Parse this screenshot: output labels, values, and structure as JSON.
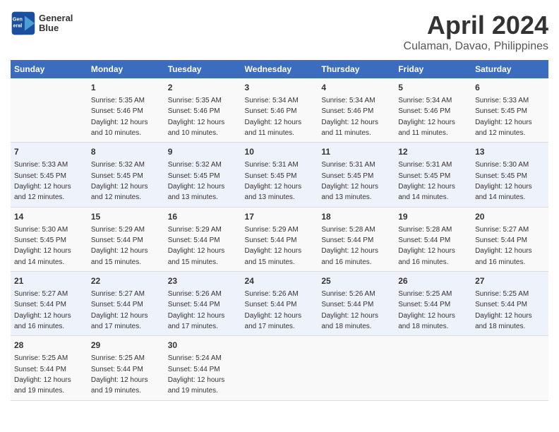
{
  "header": {
    "logo_line1": "General",
    "logo_line2": "Blue",
    "title": "April 2024",
    "subtitle": "Culaman, Davao, Philippines"
  },
  "columns": [
    "Sunday",
    "Monday",
    "Tuesday",
    "Wednesday",
    "Thursday",
    "Friday",
    "Saturday"
  ],
  "weeks": [
    [
      {
        "day": "",
        "info": ""
      },
      {
        "day": "1",
        "info": "Sunrise: 5:35 AM\nSunset: 5:46 PM\nDaylight: 12 hours\nand 10 minutes."
      },
      {
        "day": "2",
        "info": "Sunrise: 5:35 AM\nSunset: 5:46 PM\nDaylight: 12 hours\nand 10 minutes."
      },
      {
        "day": "3",
        "info": "Sunrise: 5:34 AM\nSunset: 5:46 PM\nDaylight: 12 hours\nand 11 minutes."
      },
      {
        "day": "4",
        "info": "Sunrise: 5:34 AM\nSunset: 5:46 PM\nDaylight: 12 hours\nand 11 minutes."
      },
      {
        "day": "5",
        "info": "Sunrise: 5:34 AM\nSunset: 5:46 PM\nDaylight: 12 hours\nand 11 minutes."
      },
      {
        "day": "6",
        "info": "Sunrise: 5:33 AM\nSunset: 5:45 PM\nDaylight: 12 hours\nand 12 minutes."
      }
    ],
    [
      {
        "day": "7",
        "info": "Sunrise: 5:33 AM\nSunset: 5:45 PM\nDaylight: 12 hours\nand 12 minutes."
      },
      {
        "day": "8",
        "info": "Sunrise: 5:32 AM\nSunset: 5:45 PM\nDaylight: 12 hours\nand 12 minutes."
      },
      {
        "day": "9",
        "info": "Sunrise: 5:32 AM\nSunset: 5:45 PM\nDaylight: 12 hours\nand 13 minutes."
      },
      {
        "day": "10",
        "info": "Sunrise: 5:31 AM\nSunset: 5:45 PM\nDaylight: 12 hours\nand 13 minutes."
      },
      {
        "day": "11",
        "info": "Sunrise: 5:31 AM\nSunset: 5:45 PM\nDaylight: 12 hours\nand 13 minutes."
      },
      {
        "day": "12",
        "info": "Sunrise: 5:31 AM\nSunset: 5:45 PM\nDaylight: 12 hours\nand 14 minutes."
      },
      {
        "day": "13",
        "info": "Sunrise: 5:30 AM\nSunset: 5:45 PM\nDaylight: 12 hours\nand 14 minutes."
      }
    ],
    [
      {
        "day": "14",
        "info": "Sunrise: 5:30 AM\nSunset: 5:45 PM\nDaylight: 12 hours\nand 14 minutes."
      },
      {
        "day": "15",
        "info": "Sunrise: 5:29 AM\nSunset: 5:44 PM\nDaylight: 12 hours\nand 15 minutes."
      },
      {
        "day": "16",
        "info": "Sunrise: 5:29 AM\nSunset: 5:44 PM\nDaylight: 12 hours\nand 15 minutes."
      },
      {
        "day": "17",
        "info": "Sunrise: 5:29 AM\nSunset: 5:44 PM\nDaylight: 12 hours\nand 15 minutes."
      },
      {
        "day": "18",
        "info": "Sunrise: 5:28 AM\nSunset: 5:44 PM\nDaylight: 12 hours\nand 16 minutes."
      },
      {
        "day": "19",
        "info": "Sunrise: 5:28 AM\nSunset: 5:44 PM\nDaylight: 12 hours\nand 16 minutes."
      },
      {
        "day": "20",
        "info": "Sunrise: 5:27 AM\nSunset: 5:44 PM\nDaylight: 12 hours\nand 16 minutes."
      }
    ],
    [
      {
        "day": "21",
        "info": "Sunrise: 5:27 AM\nSunset: 5:44 PM\nDaylight: 12 hours\nand 16 minutes."
      },
      {
        "day": "22",
        "info": "Sunrise: 5:27 AM\nSunset: 5:44 PM\nDaylight: 12 hours\nand 17 minutes."
      },
      {
        "day": "23",
        "info": "Sunrise: 5:26 AM\nSunset: 5:44 PM\nDaylight: 12 hours\nand 17 minutes."
      },
      {
        "day": "24",
        "info": "Sunrise: 5:26 AM\nSunset: 5:44 PM\nDaylight: 12 hours\nand 17 minutes."
      },
      {
        "day": "25",
        "info": "Sunrise: 5:26 AM\nSunset: 5:44 PM\nDaylight: 12 hours\nand 18 minutes."
      },
      {
        "day": "26",
        "info": "Sunrise: 5:25 AM\nSunset: 5:44 PM\nDaylight: 12 hours\nand 18 minutes."
      },
      {
        "day": "27",
        "info": "Sunrise: 5:25 AM\nSunset: 5:44 PM\nDaylight: 12 hours\nand 18 minutes."
      }
    ],
    [
      {
        "day": "28",
        "info": "Sunrise: 5:25 AM\nSunset: 5:44 PM\nDaylight: 12 hours\nand 19 minutes."
      },
      {
        "day": "29",
        "info": "Sunrise: 5:25 AM\nSunset: 5:44 PM\nDaylight: 12 hours\nand 19 minutes."
      },
      {
        "day": "30",
        "info": "Sunrise: 5:24 AM\nSunset: 5:44 PM\nDaylight: 12 hours\nand 19 minutes."
      },
      {
        "day": "",
        "info": ""
      },
      {
        "day": "",
        "info": ""
      },
      {
        "day": "",
        "info": ""
      },
      {
        "day": "",
        "info": ""
      }
    ]
  ]
}
